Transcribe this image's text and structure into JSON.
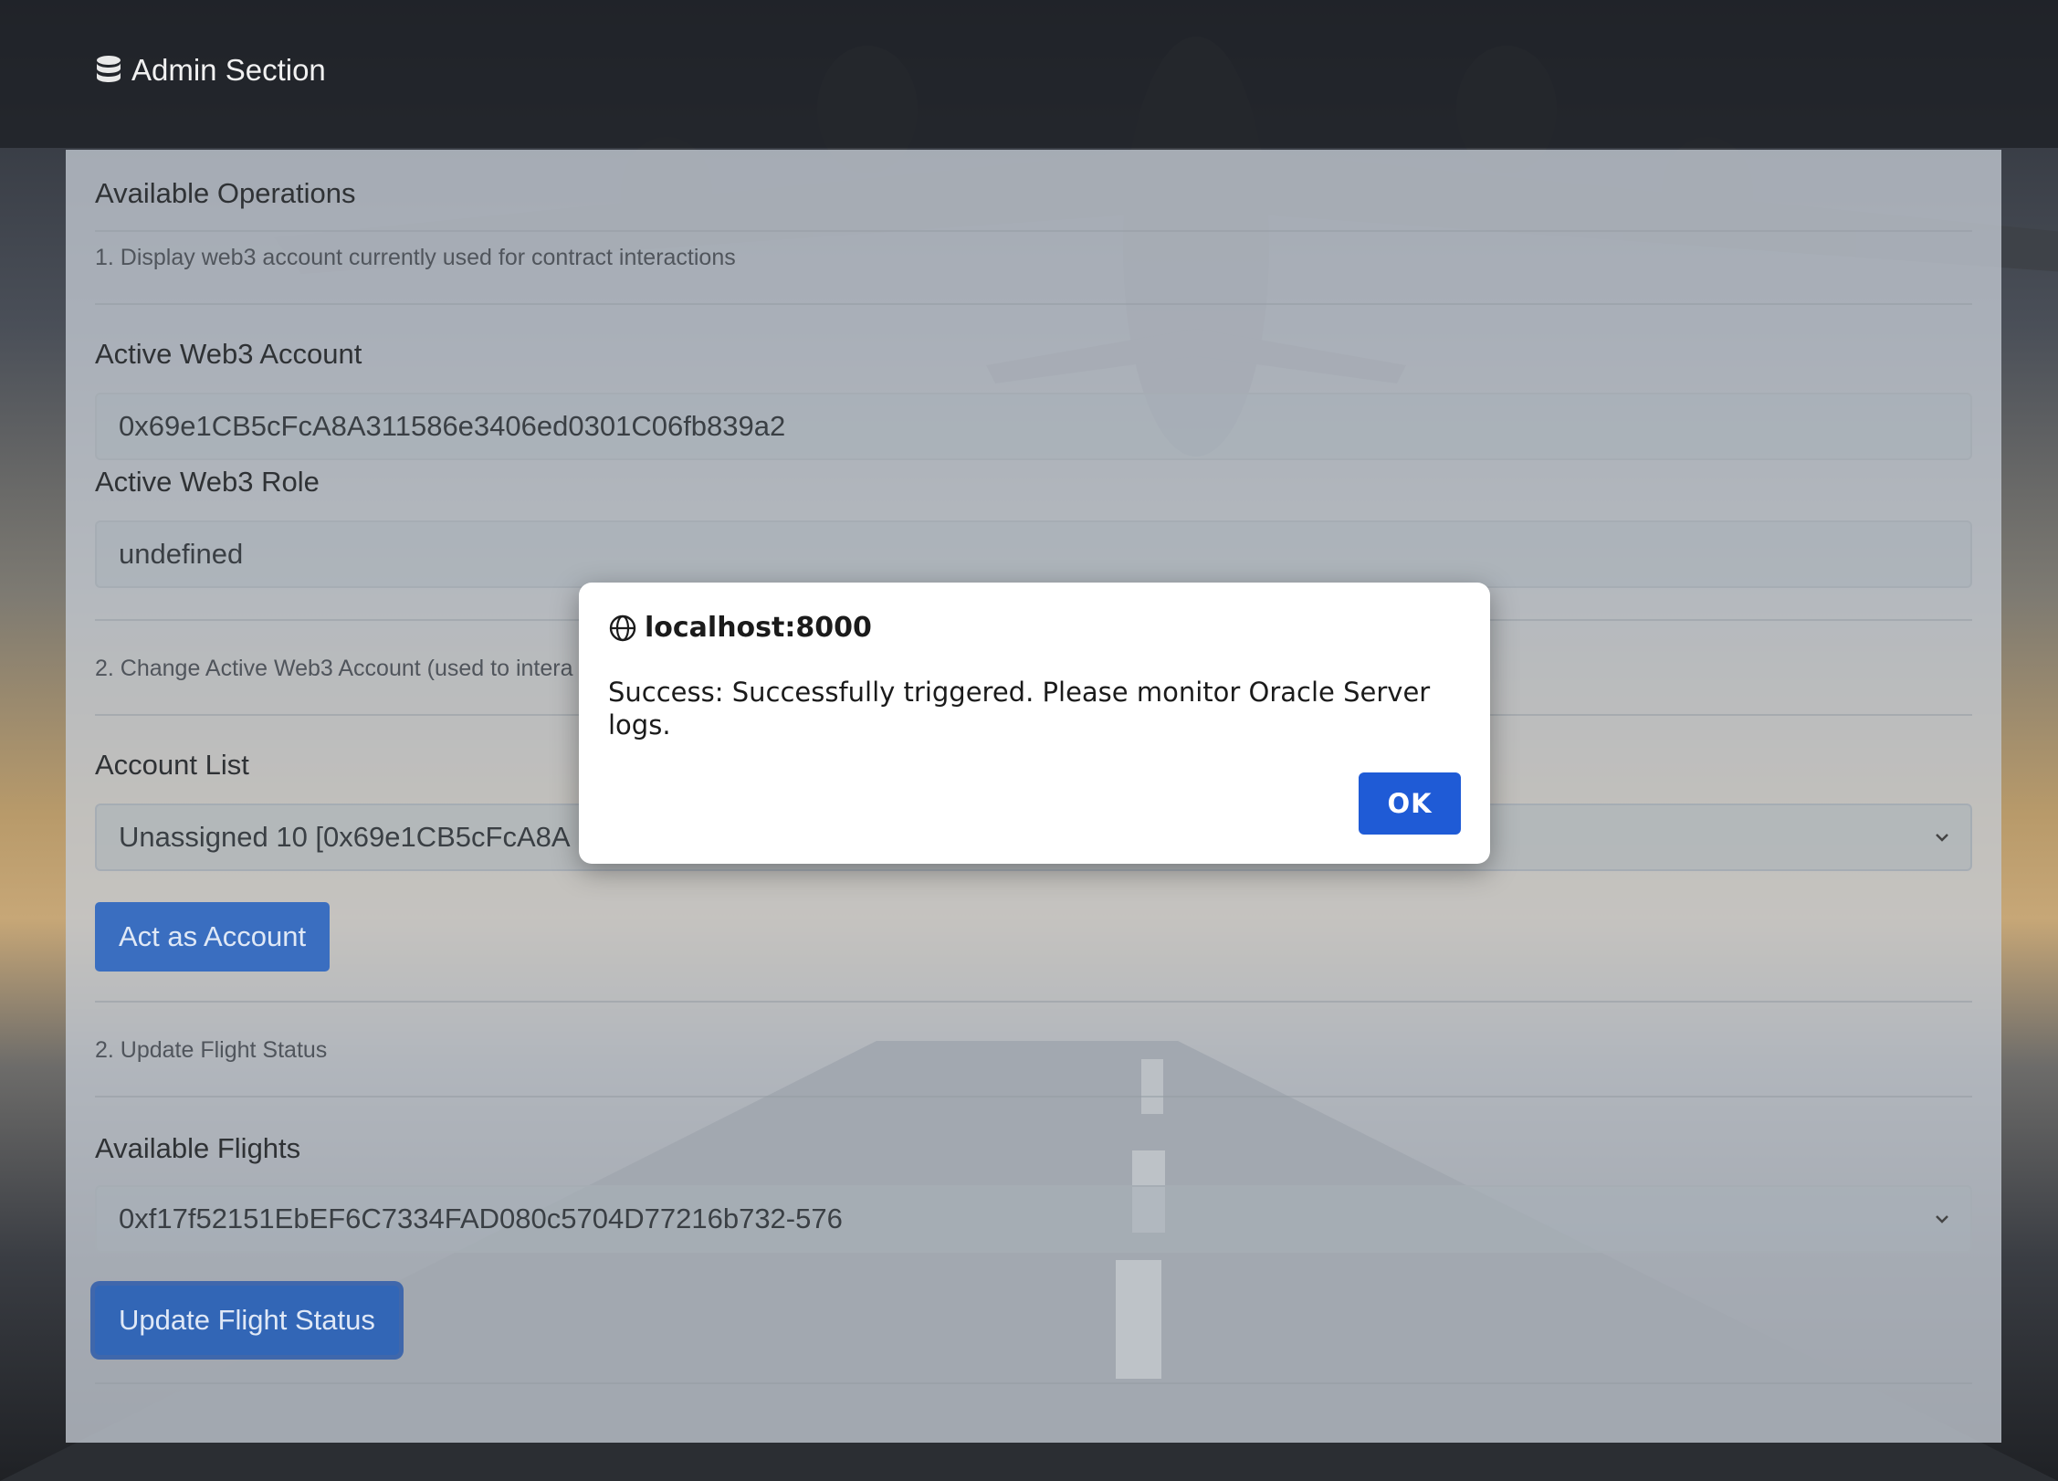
{
  "header": {
    "brand_label": "Admin Section",
    "brand_icon": "database-icon"
  },
  "operations": {
    "title": "Available Operations",
    "step1_note": "1. Display web3 account currently used for contract interactions",
    "active_account_label": "Active Web3 Account",
    "active_account_value": "0x69e1CB5cFcA8A311586e3406ed0301C06fb839a2",
    "active_role_label": "Active Web3 Role",
    "active_role_value": "undefined",
    "step2_note": "2. Change Active Web3 Account (used to intera",
    "account_list_label": "Account List",
    "account_list_selected": "Unassigned 10 [0x69e1CB5cFcA8A",
    "act_button": "Act as Account",
    "step3_note": "2. Update Flight Status",
    "flights_label": "Available Flights",
    "flights_selected": "0xf17f52151EbEF6C7334FAD080c5704D77216b732-576",
    "update_button": "Update Flight Status"
  },
  "dialog": {
    "origin": "localhost:8000",
    "message": "Success: Successfully triggered. Please monitor Oracle Server logs.",
    "ok_label": "OK"
  },
  "colors": {
    "primary": "#3a6ec0",
    "dialog_ok": "#1f5bd6"
  }
}
